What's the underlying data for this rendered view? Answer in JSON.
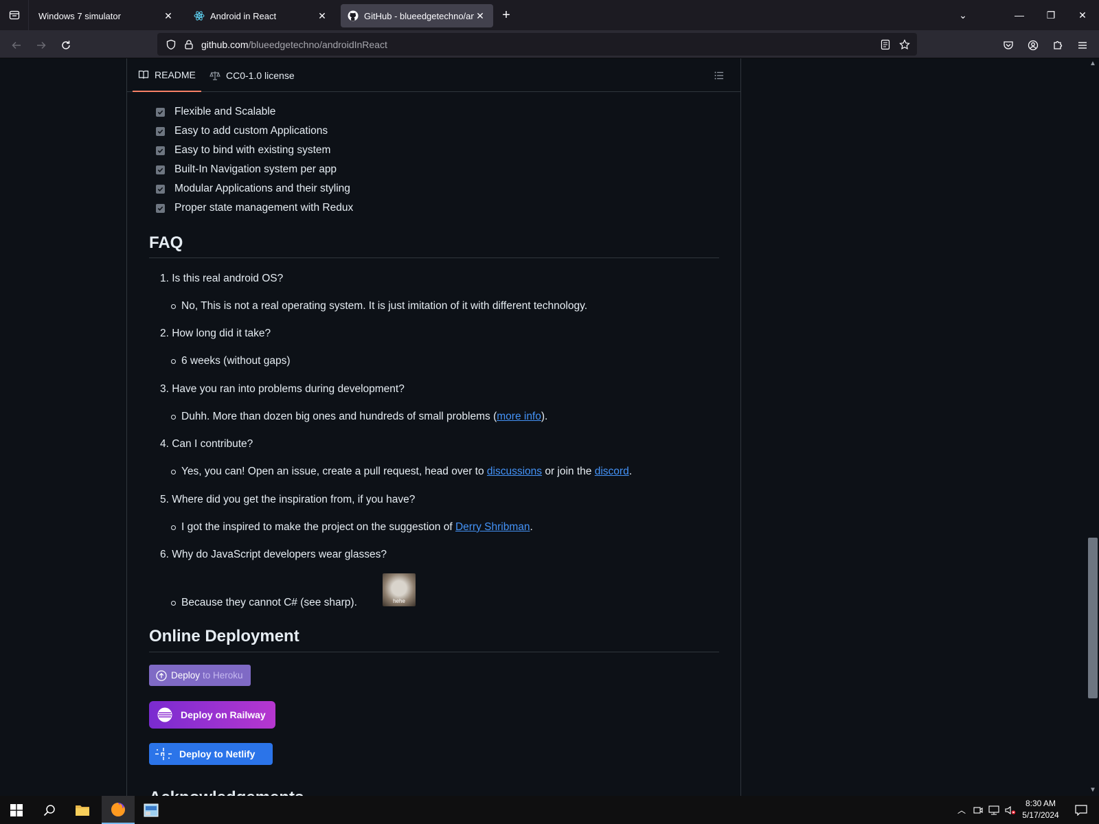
{
  "browser": {
    "tabs": [
      {
        "title": "Windows 7 simulator",
        "icon": "none",
        "active": false
      },
      {
        "title": "Android in React",
        "icon": "react-icon",
        "active": false
      },
      {
        "title": "GitHub - blueedgetechno/andr",
        "icon": "github-icon",
        "active": true
      }
    ],
    "url_host": "github.com",
    "url_path": "/blueedgetechno/androidInReact"
  },
  "readme_tabs": {
    "readme": "README",
    "license": "CC0-1.0 license"
  },
  "features": [
    "Flexible and Scalable",
    "Easy to add custom Applications",
    "Easy to bind with existing system",
    "Built-In Navigation system per app",
    "Modular Applications and their styling",
    "Proper state management with Redux"
  ],
  "faq": {
    "heading": "FAQ",
    "q1": "1. Is this real android OS?",
    "a1": "No, This is not a real operating system. It is just imitation of it with different technology.",
    "q2": "2. How long did it take?",
    "a2": "6 weeks (without gaps)",
    "q3": "3. Have you ran into problems during development?",
    "a3_before": "Duhh. More than dozen big ones and hundreds of small problems (",
    "a3_link": "more info",
    "a3_after": ").",
    "q4": "4. Can I contribute?",
    "a4_before": "Yes, you can! Open an issue, create a pull request, head over to ",
    "a4_link1": "discussions",
    "a4_mid": " or join the ",
    "a4_link2": "discord",
    "a4_after": ".",
    "q5": "5. Where did you get the inspiration from, if you have?",
    "a5_before": "I got the inspired to make the project on the suggestion of ",
    "a5_link": "Derry Shribman",
    "a5_after": ".",
    "q6": "6. Why do JavaScript developers wear glasses?",
    "a6": "Because they cannot C# (see sharp).",
    "a6_image_caption": "hehe"
  },
  "deployment": {
    "heading": "Online Deployment",
    "heroku_a": "Deploy",
    "heroku_b": "to Heroku",
    "railway": "Deploy on Railway",
    "netlify": "Deploy to Netlify"
  },
  "next_heading": "Acknowledgements",
  "taskbar": {
    "time": "8:30 AM",
    "date": "5/17/2024"
  },
  "colors": {
    "page_bg": "#0d1117",
    "link": "#4493f8",
    "active_tab_underline": "#f78166"
  }
}
